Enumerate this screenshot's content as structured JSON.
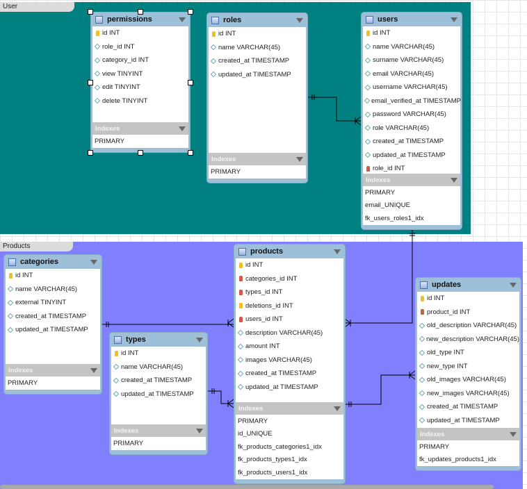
{
  "layers": {
    "user": "User",
    "products": "Products"
  },
  "colors": {
    "user_layer": "#008080",
    "products_layer": "#8080ff",
    "table_header": "#9dc0d8",
    "indexes_bar": "#c4c4c4"
  },
  "indexes_label": "Indexes",
  "tables": {
    "permissions": {
      "name": "permissions",
      "selected": true,
      "columns": [
        {
          "name": "id INT",
          "key": "pk"
        },
        {
          "name": "role_id INT",
          "key": "col"
        },
        {
          "name": "category_id INT",
          "key": "col"
        },
        {
          "name": "view TINYINT",
          "key": "col"
        },
        {
          "name": "edit TINYINT",
          "key": "col"
        },
        {
          "name": "delete TINYINT",
          "key": "col"
        }
      ],
      "indexes": [
        "PRIMARY"
      ]
    },
    "roles": {
      "name": "roles",
      "columns": [
        {
          "name": "id INT",
          "key": "pk"
        },
        {
          "name": "name VARCHAR(45)",
          "key": "col"
        },
        {
          "name": "created_at TIMESTAMP",
          "key": "col"
        },
        {
          "name": "updated_at TIMESTAMP",
          "key": "col"
        }
      ],
      "indexes": [
        "PRIMARY"
      ]
    },
    "users": {
      "name": "users",
      "columns": [
        {
          "name": "id INT",
          "key": "pk"
        },
        {
          "name": "name VARCHAR(45)",
          "key": "col"
        },
        {
          "name": "surname VARCHAR(45)",
          "key": "col"
        },
        {
          "name": "email VARCHAR(45)",
          "key": "col"
        },
        {
          "name": "username VARCHAR(45)",
          "key": "col"
        },
        {
          "name": "email_verified_at TIMESTAMP",
          "key": "col"
        },
        {
          "name": "password VARCHAR(45)",
          "key": "col"
        },
        {
          "name": "role VARCHAR(45)",
          "key": "col"
        },
        {
          "name": "created_at TIMESTAMP",
          "key": "col"
        },
        {
          "name": "updated_at TIMESTAMP",
          "key": "col"
        },
        {
          "name": "role_id INT",
          "key": "fk"
        }
      ],
      "indexes": [
        "PRIMARY",
        "email_UNIQUE",
        "fk_users_roles1_idx"
      ]
    },
    "categories": {
      "name": "categories",
      "columns": [
        {
          "name": "id INT",
          "key": "pk"
        },
        {
          "name": "name VARCHAR(45)",
          "key": "col"
        },
        {
          "name": "external TINYINT",
          "key": "col"
        },
        {
          "name": "created_at TIMESTAMP",
          "key": "col"
        },
        {
          "name": "updated_at TIMESTAMP",
          "key": "col"
        }
      ],
      "indexes": [
        "PRIMARY"
      ]
    },
    "types": {
      "name": "types",
      "columns": [
        {
          "name": "id INT",
          "key": "pk"
        },
        {
          "name": "name VARCHAR(45)",
          "key": "col"
        },
        {
          "name": "created_at TIMESTAMP",
          "key": "col"
        },
        {
          "name": "updated_at TIMESTAMP",
          "key": "col"
        }
      ],
      "indexes": [
        "PRIMARY"
      ]
    },
    "products": {
      "name": "products",
      "columns": [
        {
          "name": "id INT",
          "key": "pk"
        },
        {
          "name": "categories_id INT",
          "key": "fk"
        },
        {
          "name": "types_id INT",
          "key": "fk"
        },
        {
          "name": "deletions_id INT",
          "key": "pk"
        },
        {
          "name": "users_id INT",
          "key": "fk"
        },
        {
          "name": "description VARCHAR(45)",
          "key": "col"
        },
        {
          "name": "amount INT",
          "key": "col"
        },
        {
          "name": "images VARCHAR(45)",
          "key": "col"
        },
        {
          "name": "created_at TIMESTAMP",
          "key": "col"
        },
        {
          "name": "updated_at TIMESTAMP",
          "key": "col"
        }
      ],
      "indexes": [
        "PRIMARY",
        "id_UNIQUE",
        "fk_products_categories1_idx",
        "fk_products_types1_idx",
        "fk_products_users1_idx"
      ]
    },
    "updates": {
      "name": "updates",
      "columns": [
        {
          "name": "id INT",
          "key": "pk"
        },
        {
          "name": "product_id INT",
          "key": "fk"
        },
        {
          "name": "old_description VARCHAR(45)",
          "key": "col"
        },
        {
          "name": "new_description VARCHAR(45)",
          "key": "col"
        },
        {
          "name": "old_type INT",
          "key": "col"
        },
        {
          "name": "new_type INT",
          "key": "col"
        },
        {
          "name": "old_images VARCHAR(45)",
          "key": "col"
        },
        {
          "name": "new_images VARCHAR(45)",
          "key": "col"
        },
        {
          "name": "created_at TIMESTAMP",
          "key": "col"
        },
        {
          "name": "updated_at TIMESTAMP",
          "key": "col"
        }
      ],
      "indexes": [
        "PRIMARY",
        "fk_updates_products1_idx"
      ]
    }
  },
  "relationships": [
    {
      "from": "roles",
      "to": "users",
      "type": "one-to-many"
    },
    {
      "from": "users",
      "to": "products",
      "type": "one-to-many"
    },
    {
      "from": "categories",
      "to": "products",
      "type": "one-to-many"
    },
    {
      "from": "types",
      "to": "products",
      "type": "one-to-many"
    },
    {
      "from": "products",
      "to": "updates",
      "type": "one-to-many"
    }
  ]
}
